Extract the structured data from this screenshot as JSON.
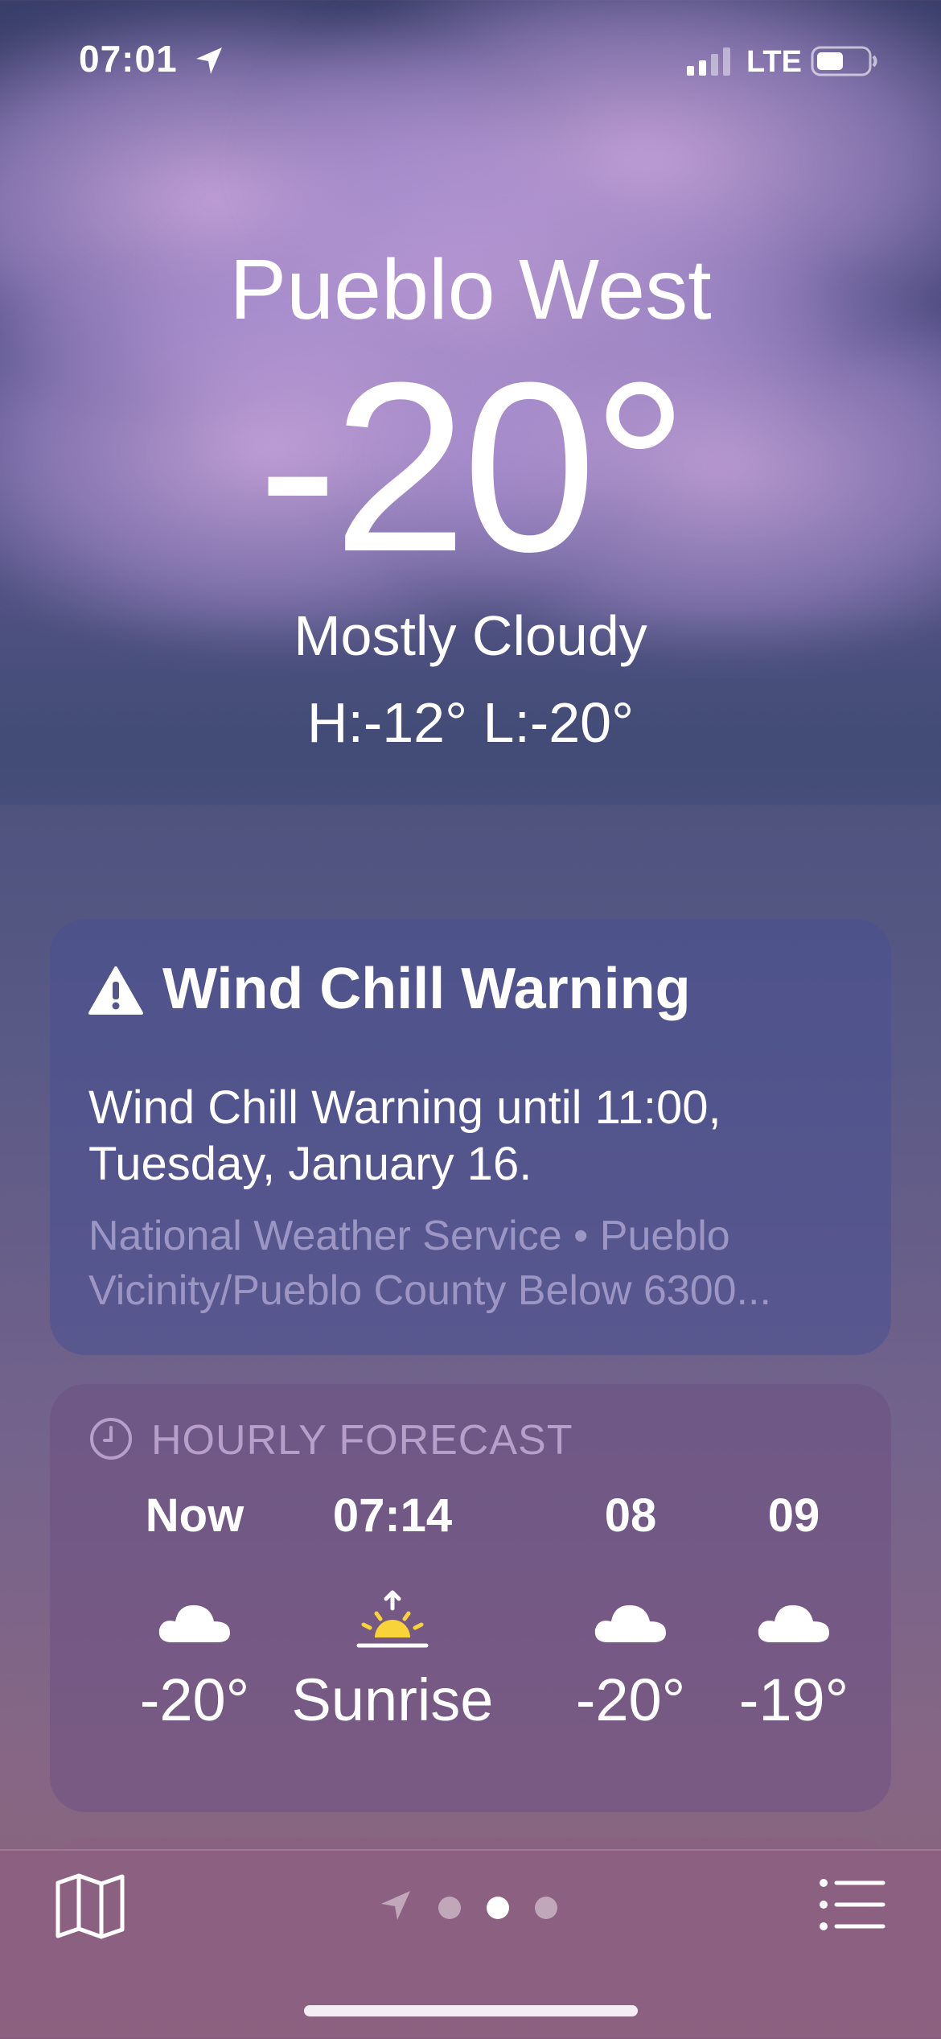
{
  "status_bar": {
    "time": "07:01",
    "network": "LTE",
    "icons": [
      "location-arrow-icon",
      "signal-icon",
      "battery-icon"
    ]
  },
  "header": {
    "city": "Pueblo West",
    "temperature": "-20°",
    "condition": "Mostly Cloudy",
    "hi_lo": "H:-12°  L:-20°"
  },
  "alert": {
    "icon": "warning-triangle-icon",
    "title": "Wind Chill Warning",
    "body": "Wind Chill Warning until 11:00, Tuesday, January 16.",
    "source": "National Weather Service • Pueblo Vicinity/Pueblo County Below 6300..."
  },
  "hourly": {
    "header": "HOURLY FORECAST",
    "icon": "clock-icon",
    "items": [
      {
        "label": "Now",
        "icon": "cloud-icon",
        "value": "-20°"
      },
      {
        "label": "07:14",
        "icon": "sunrise-icon",
        "value": "Sunrise"
      },
      {
        "label": "08",
        "icon": "cloud-icon",
        "value": "-20°"
      },
      {
        "label": "09",
        "icon": "cloud-icon",
        "value": "-19°"
      }
    ]
  },
  "toolbar": {
    "map_icon": "map-icon",
    "list_icon": "list-icon",
    "pages_count": 3,
    "active_page": 2
  },
  "colors": {
    "sunrise_yellow": "#f9d33a",
    "text": "#ffffff",
    "muted_text": "#c8bee6"
  }
}
